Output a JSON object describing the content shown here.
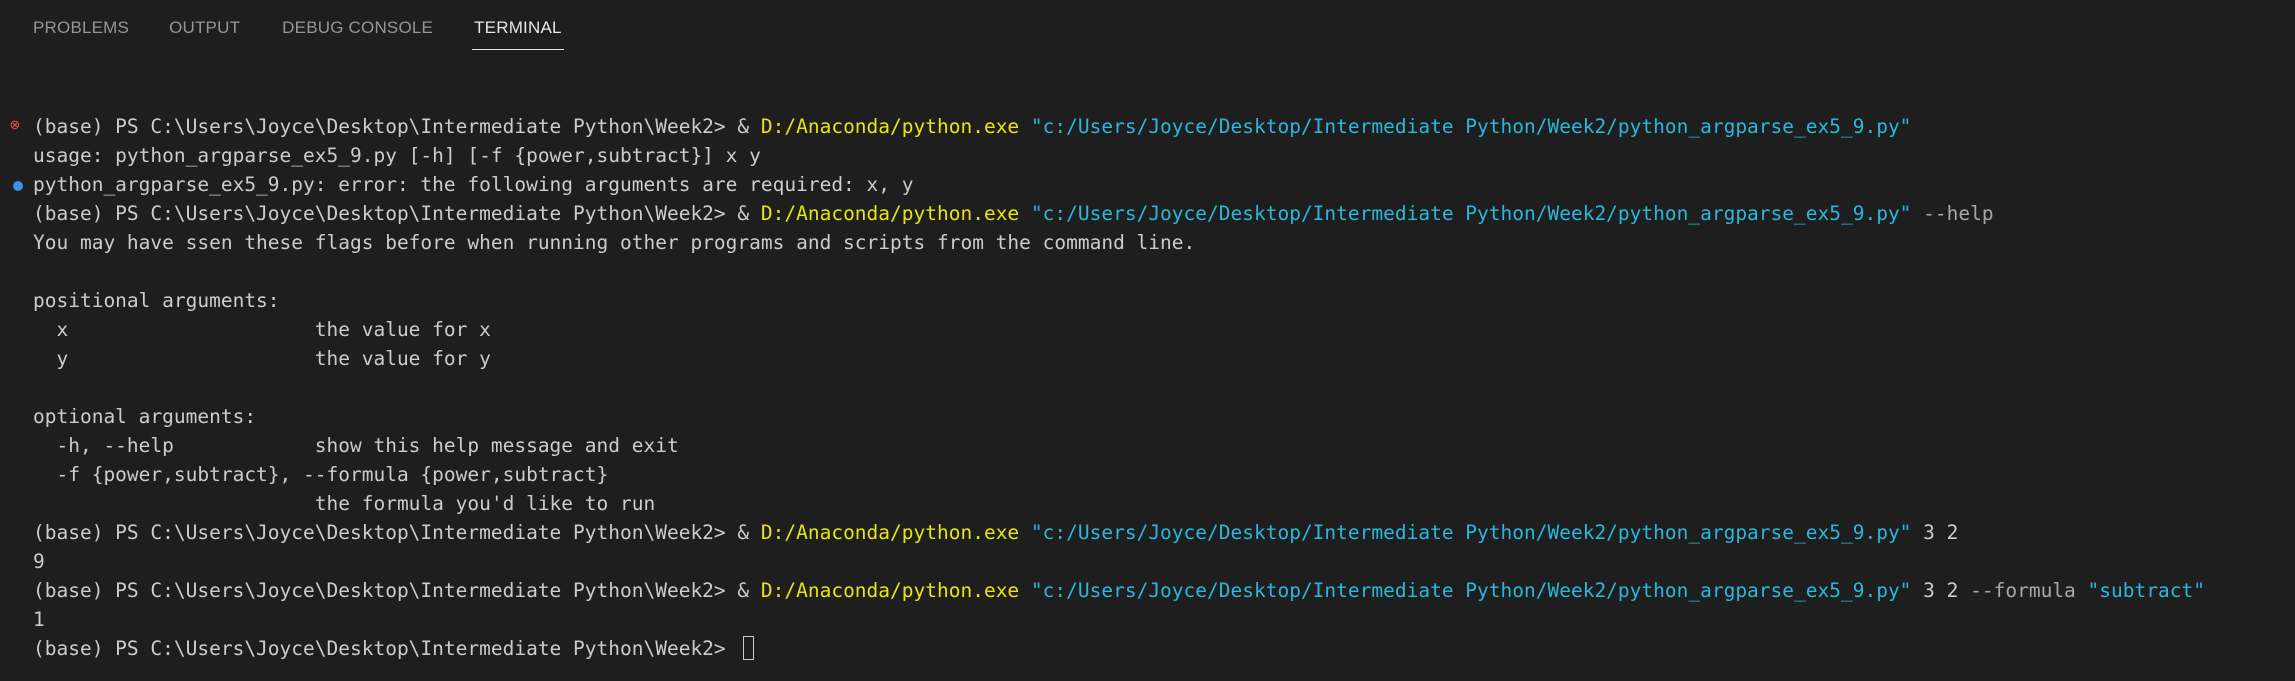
{
  "panel_tabs": [
    "PROBLEMS",
    "OUTPUT",
    "DEBUG CONSOLE",
    "TERMINAL"
  ],
  "active_tab": "TERMINAL",
  "terminal": {
    "prompt": "(base) PS C:\\Users\\Joyce\\Desktop\\Intermediate Python\\Week2> ",
    "amp": "& ",
    "exe": "D:/Anaconda/python.exe",
    "script": "\"c:/Users/Joyce/Desktop/Intermediate Python/Week2/python_argparse_ex5_9.py\"",
    "cmd2_args": " --help",
    "cmd3_args": " 3 2",
    "cmd4_args_plain": " 3 2 ",
    "cmd4_flag": "--formula ",
    "cmd4_value": "\"subtract\"",
    "output": {
      "usage": "usage: python_argparse_ex5_9.py [-h] [-f {power,subtract}] x y",
      "error": "python_argparse_ex5_9.py: error: the following arguments are required: x, y",
      "description": "You may have ssen these flags before when running other programs and scripts from the command line.",
      "positional_header": "positional arguments:",
      "pos_x": "  x                     the value for x",
      "pos_y": "  y                     the value for y",
      "optional_header": "optional arguments:",
      "opt_help": "  -h, --help            show this help message and exit",
      "opt_formula": "  -f {power,subtract}, --formula {power,subtract}",
      "opt_formula_desc": "                        the formula you'd like to run",
      "result_power": "9",
      "result_subtract": "1"
    },
    "decorations": {
      "error_icon": "x-circle-icon",
      "info_icon": "dot-icon",
      "error_color": "#f14c4c",
      "info_color": "#3b8eea"
    }
  },
  "colors": {
    "background": "#1e1e1e",
    "text": "#cccccc",
    "exe": "#e5e510",
    "string": "#29b8db",
    "arg": "#a8a8a8"
  }
}
